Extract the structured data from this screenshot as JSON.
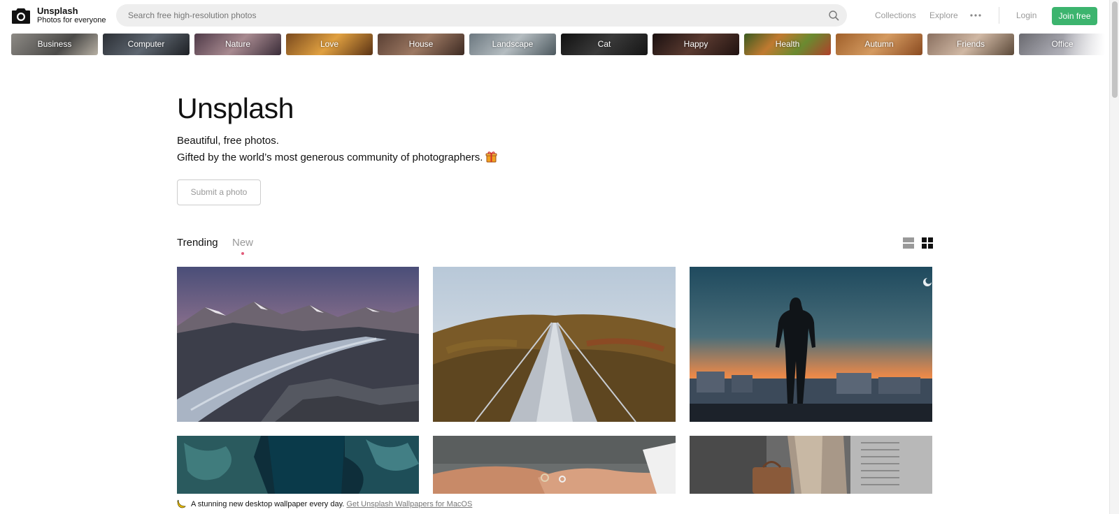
{
  "header": {
    "brand_name": "Unsplash",
    "brand_tagline": "Photos for everyone",
    "search_placeholder": "Search free high-resolution photos",
    "nav": {
      "collections": "Collections",
      "explore": "Explore",
      "login": "Login",
      "join": "Join free"
    },
    "icons": {
      "logo": "camera-icon",
      "search": "search-icon",
      "more": "more-icon"
    },
    "join_color": "#3cb46e"
  },
  "categories": [
    "Business",
    "Computer",
    "Nature",
    "Love",
    "House",
    "Landscape",
    "Cat",
    "Happy",
    "Health",
    "Autumn",
    "Friends",
    "Office"
  ],
  "hero": {
    "title": "Unsplash",
    "line1": "Beautiful, free photos.",
    "line2": "Gifted by the world’s most generous community of photographers.",
    "submit": "Submit a photo"
  },
  "tabs": {
    "trending": "Trending",
    "new": "New"
  },
  "banner": {
    "text": "A stunning new desktop wallpaper every day.",
    "link": "Get Unsplash Wallpapers for MacOS"
  }
}
